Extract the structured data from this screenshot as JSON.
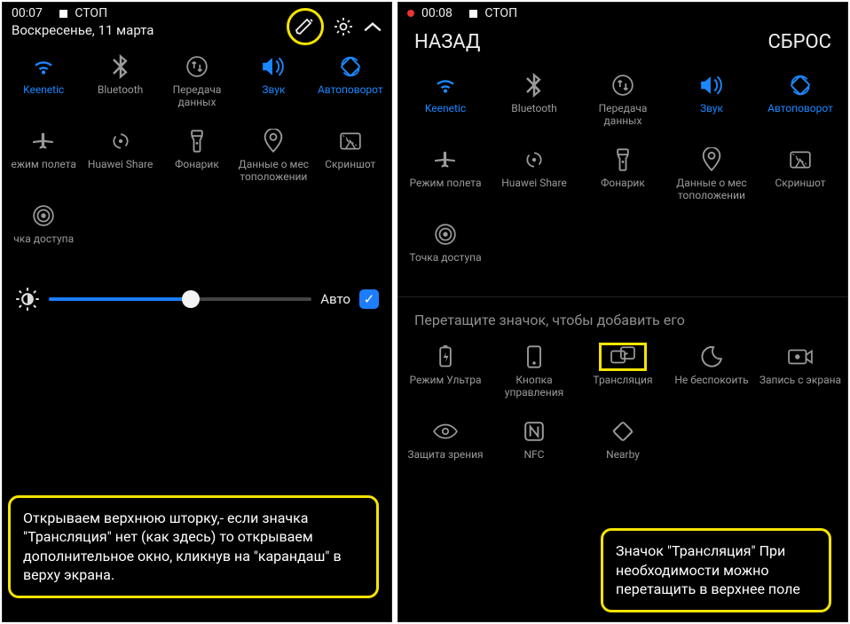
{
  "left": {
    "status": {
      "time": "00:07",
      "indicator_label": "СТОП"
    },
    "date": "Воскресенье, 11 марта",
    "brightness": {
      "auto_label": "Авто",
      "percent": 54,
      "auto_checked": true
    },
    "tiles": [
      {
        "icon": "wifi-icon",
        "label": "Keenetic",
        "active": true
      },
      {
        "icon": "bluetooth-icon",
        "label": "Bluetooth",
        "active": false
      },
      {
        "icon": "data-transfer-icon",
        "label": "Передача данных",
        "active": false
      },
      {
        "icon": "sound-icon",
        "label": "Звук",
        "active": true
      },
      {
        "icon": "autorotate-icon",
        "label": "Автоповорот",
        "active": true
      },
      {
        "icon": "airplane-icon",
        "label": "ежим полета",
        "active": false
      },
      {
        "icon": "huawei-share-icon",
        "label": "Huawei Share",
        "active": false
      },
      {
        "icon": "flashlight-icon",
        "label": "Фонарик",
        "active": false
      },
      {
        "icon": "location-icon",
        "label": "Данные о мес тоположении",
        "active": false
      },
      {
        "icon": "screenshot-icon",
        "label": "Скриншот",
        "active": false
      },
      {
        "icon": "hotspot-icon",
        "label": "чка доступа",
        "active": false
      }
    ],
    "callout": "Открываем верхнюю шторку,- если значка \"Трансляция\" нет (как здесь) то открываем дополнительное окно, кликнув на \"карандаш\" в верху экрана."
  },
  "right": {
    "status": {
      "time": "00:08",
      "indicator_label": "СТОП"
    },
    "nav": {
      "back": "НАЗАД",
      "reset": "СБРОС"
    },
    "tiles": [
      {
        "icon": "wifi-icon",
        "label": "Keenetic",
        "active": true
      },
      {
        "icon": "bluetooth-icon",
        "label": "Bluetooth",
        "active": false
      },
      {
        "icon": "data-transfer-icon",
        "label": "Передача данных",
        "active": false
      },
      {
        "icon": "sound-icon",
        "label": "Звук",
        "active": true
      },
      {
        "icon": "autorotate-icon",
        "label": "Автоповорот",
        "active": true
      },
      {
        "icon": "airplane-icon",
        "label": "Режим полета",
        "active": false
      },
      {
        "icon": "huawei-share-icon",
        "label": "Huawei Share",
        "active": false
      },
      {
        "icon": "flashlight-icon",
        "label": "Фонарик",
        "active": false
      },
      {
        "icon": "location-icon",
        "label": "Данные о мес тоположении",
        "active": false
      },
      {
        "icon": "screenshot-icon",
        "label": "Скриншот",
        "active": false
      },
      {
        "icon": "hotspot-icon",
        "label": "Точка доступа",
        "active": false
      }
    ],
    "drag_hint": "Перетащите значок, чтобы добавить его",
    "extra_tiles": [
      {
        "icon": "ultra-battery-icon",
        "label": "Режим Ультра",
        "highlight": false
      },
      {
        "icon": "nav-button-icon",
        "label": "Кнопка управления",
        "highlight": false
      },
      {
        "icon": "cast-icon",
        "label": "Трансляция",
        "highlight": true
      },
      {
        "icon": "dnd-icon",
        "label": "Не беспокоить",
        "highlight": false
      },
      {
        "icon": "screen-record-icon",
        "label": "Запись с экрана",
        "highlight": false
      },
      {
        "icon": "eye-comfort-icon",
        "label": "Защита зрения",
        "highlight": false
      },
      {
        "icon": "nfc-icon",
        "label": "NFC",
        "highlight": false
      },
      {
        "icon": "nearby-icon",
        "label": "Nearby",
        "highlight": false
      }
    ],
    "callout": "Значок \"Трансляция\" При необходимости можно перетащить в верхнее поле"
  },
  "icons_svg": {
    "wifi-icon": "<svg width='26' height='22' viewBox='0 0 24 20'><path d='M12 18a2 2 0 100-4 2 2 0 000 4zm-5-6a8 8 0 0110 0l-1.6 1.6a5.6 5.6 0 00-6.8 0L7 12zm-4-4a14 14 0 0118 0l-1.6 1.6a11.6 11.6 0 00-14.8 0L3 8z' fill='currentColor'/></svg>",
    "bluetooth-icon": "<svg width='20' height='28' viewBox='0 0 14 22'><path d='M6 0v8.6L1.4 4 0 5.4 5.6 11 0 16.6 1.4 18 6 13.4V22l7-6-4.8-5L13 6 6 0zm2 3.8L10.2 6 8 8.2V3.8zm0 10L10.2 16 8 18.2v-4.4z' fill='currentColor'/></svg>",
    "data-transfer-icon": "<svg width='26' height='26' viewBox='0 0 24 24'><circle cx='12' cy='12' r='10' fill='none' stroke='currentColor' stroke-width='1.6'/><path d='M9 7v7m0-7l-2 2m2-2l2 2M15 17V10m0 7l-2-2m2 2l2-2' stroke='currentColor' stroke-width='1.6' fill='none'/></svg>",
    "sound-icon": "<svg width='28' height='24' viewBox='0 0 26 22'><path d='M2 7h4l6-5v18l-6-5H2V7z' fill='currentColor'/><path d='M16 5a8 8 0 010 12M19 2a12 12 0 010 18' stroke='currentColor' stroke-width='1.8' fill='none'/></svg>",
    "autorotate-icon": "<svg width='26' height='26' viewBox='0 0 24 24'><rect x='5' y='5' width='14' height='14' rx='2' transform='rotate(45 12 12)' fill='none' stroke='currentColor' stroke-width='1.8'/><path d='M3 10a9 9 0 0116-4M21 14a9 9 0 01-16 4' stroke='currentColor' stroke-width='1.6' fill='none'/></svg>",
    "airplane-icon": "<svg width='26' height='26' viewBox='0 0 24 24'><path d='M22 12l-9-1V5a1.5 1.5 0 00-3 0v6l-9 1v2l9-1v4l-2 1v2l3.5-1 3.5 1v-2l-2-1v-4l9 1v-2z' fill='currentColor'/></svg>",
    "huawei-share-icon": "<svg width='26' height='26' viewBox='0 0 24 24'><circle cx='12' cy='12' r='2' fill='currentColor'/><path d='M12 5a7 7 0 017 7M12 19a7 7 0 01-7-7M7 7a7 7 0 000 10M17 7a7 7 0 010 10' stroke='currentColor' stroke-width='1.6' fill='none'/></svg>",
    "flashlight-icon": "<svg width='20' height='28' viewBox='0 0 16 24'><rect x='3' y='2' width='10' height='5' rx='1' fill='none' stroke='currentColor' stroke-width='1.6'/><path d='M3 7l2 4v10a1 1 0 001 1h4a1 1 0 001-1V11l2-4' fill='none' stroke='currentColor' stroke-width='1.6'/><circle cx='8' cy='14' r='1.2' fill='currentColor'/></svg>",
    "location-icon": "<svg width='22' height='28' viewBox='0 0 18 24'><path d='M9 0a8 8 0 018 8c0 6-8 14-8 14S1 14 1 8a8 8 0 018-8z' fill='none' stroke='currentColor' stroke-width='1.6'/><circle cx='9' cy='8' r='3' fill='none' stroke='currentColor' stroke-width='1.6'/></svg>",
    "screenshot-icon": "<svg width='26' height='22' viewBox='0 0 24 20'><rect x='2' y='2' width='20' height='16' rx='2' fill='none' stroke='currentColor' stroke-width='1.6'/><path d='M7 18l5-8 5 8M8 8l2 3' stroke='currentColor' stroke-width='1.4' fill='none'/><path d='M4 4l16 12' stroke='currentColor' stroke-width='1' stroke-dasharray='2 2'/></svg>",
    "hotspot-icon": "<svg width='26' height='26' viewBox='0 0 24 24'><circle cx='12' cy='12' r='2.5' fill='currentColor'/><circle cx='12' cy='12' r='6' fill='none' stroke='currentColor' stroke-width='1.6'/><circle cx='12' cy='12' r='10' fill='none' stroke='currentColor' stroke-width='1.6'/></svg>",
    "ultra-battery-icon": "<svg width='20' height='28' viewBox='0 0 16 24'><rect x='3' y='3' width='10' height='18' rx='2' fill='none' stroke='currentColor' stroke-width='1.6'/><rect x='6' y='1' width='4' height='2' fill='currentColor'/><path d='M9 7l-3 6h3l-1 4 3-6H8l1-4z' fill='currentColor'/></svg>",
    "nav-button-icon": "<svg width='20' height='28' viewBox='0 0 16 24'><rect x='2' y='2' width='12' height='20' rx='2' fill='none' stroke='currentColor' stroke-width='1.6'/><circle cx='8' cy='18' r='1.5' fill='currentColor'/></svg>",
    "cast-icon": "<svg width='28' height='24' viewBox='0 0 26 22'><rect x='1' y='5' width='14' height='12' rx='2' fill='none' stroke='currentColor' stroke-width='1.6'/><rect x='11' y='1' width='14' height='12' rx='2' fill='none' stroke='currentColor' stroke-width='1.6'/><path d='M14 9l4-2' stroke='currentColor' stroke-width='1.6'/></svg>",
    "dnd-icon": "<svg width='26' height='26' viewBox='0 0 24 24'><path d='M14 2a10 10 0 108 12A8 8 0 0114 2z' fill='none' stroke='currentColor' stroke-width='1.8'/></svg>",
    "screen-record-icon": "<svg width='28' height='22' viewBox='0 0 26 20'><rect x='1' y='3' width='18' height='14' rx='2' fill='none' stroke='currentColor' stroke-width='1.6'/><path d='M19 8l6-4v12l-6-4z' fill='none' stroke='currentColor' stroke-width='1.6'/><circle cx='10' cy='10' r='2.5' fill='currentColor'/></svg>",
    "eye-comfort-icon": "<svg width='28' height='20' viewBox='0 0 26 18'><path d='M1 9s4-7 12-7 12 7 12 7-4 7-12 7S1 9 1 9z' fill='none' stroke='currentColor' stroke-width='1.6'/><circle cx='13' cy='9' r='3' fill='none' stroke='currentColor' stroke-width='1.6'/></svg>",
    "nfc-icon": "<svg width='24' height='24' viewBox='0 0 22 22'><rect x='2' y='2' width='18' height='18' rx='3' fill='none' stroke='currentColor' stroke-width='1.8'/><path d='M7 16V6l8 10V6' stroke='currentColor' stroke-width='1.8' fill='none'/></svg>",
    "nearby-icon": "<svg width='26' height='26' viewBox='0 0 24 24'><rect x='5' y='5' width='14' height='14' rx='2' transform='rotate(45 12 12)' fill='none' stroke='currentColor' stroke-width='1.8'/><path d='M2 12l5-5M22 12l-5 5' stroke='currentColor' stroke-width='1.8'/></svg>",
    "pencil-icon": "<svg width='24' height='24' viewBox='0 0 24 24'><path d='M3 19l3 1 12-12-4-4L2 16l1 3zm15-15l2 2' stroke='#eee' stroke-width='1.8' fill='none'/></svg>",
    "gear-icon": "<svg width='24' height='24' viewBox='0 0 24 24'><circle cx='12' cy='12' r='3.5' fill='none' stroke='#eee' stroke-width='1.8'/><path d='M12 2v3m0 14v3M2 12h3m14 0h3M5 5l2 2m10 10l2 2M5 19l2-2m10-10l2-2' stroke='#eee' stroke-width='1.8'/></svg>",
    "chevron-up-icon": "<svg width='22' height='14' viewBox='0 0 20 12'><path d='M2 10l8-7 8 7' stroke='#eee' stroke-width='2.2' fill='none'/></svg>",
    "brightness-icon": "<svg width='28' height='28' viewBox='0 0 24 24'><circle cx='12' cy='12' r='5' fill='none' stroke='#ddd' stroke-width='1.8'/><path d='M12 1v3m0 16v3M1 12h3m16 0h3M4 4l2 2m12 12l2 2M4 20l2-2m12-12l2-2' stroke='#ddd' stroke-width='1.8'/><path d='M12 7a5 5 0 010 10z' fill='#ddd'/></svg>"
  }
}
